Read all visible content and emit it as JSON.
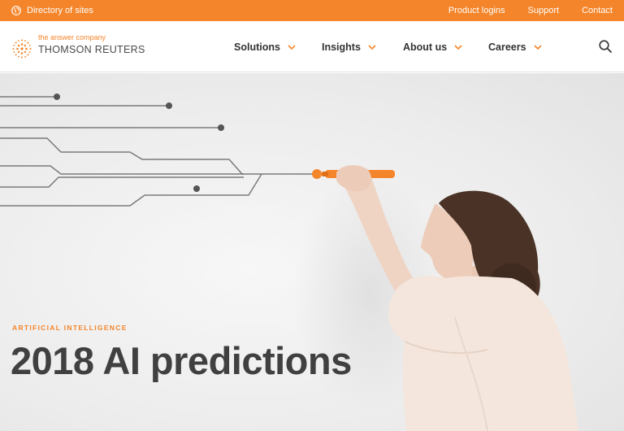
{
  "topbar": {
    "directory_label": "Directory of sites",
    "links": [
      "Product logins",
      "Support",
      "Contact"
    ]
  },
  "header": {
    "logo_tagline": "the answer company",
    "logo_brand": "THOMSON REUTERS",
    "nav": [
      "Solutions",
      "Insights",
      "About us",
      "Careers"
    ],
    "search_icon": "search-icon"
  },
  "hero": {
    "kicker": "ARTIFICIAL INTELLIGENCE",
    "headline": "2018 AI predictions",
    "image": "woman drawing circuit lines on whiteboard with orange marker"
  },
  "colors": {
    "accent": "#f5852a",
    "text": "#404040",
    "hero_background": "#ececec"
  }
}
